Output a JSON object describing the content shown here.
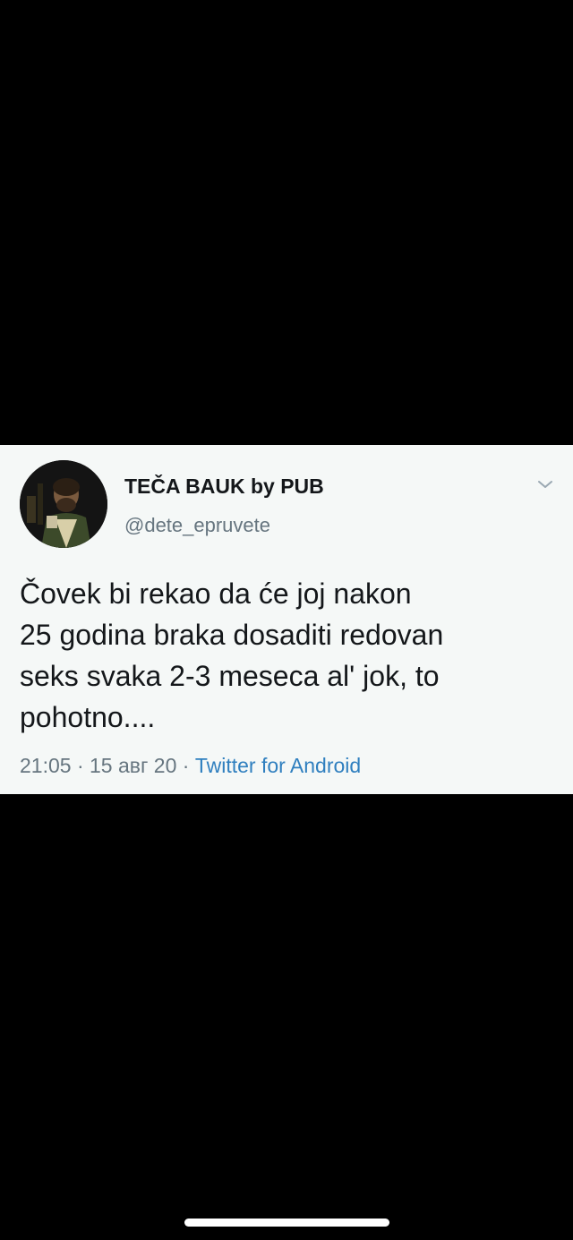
{
  "tweet": {
    "author_name": "TEČA BAUK by PUB",
    "author_handle": "@dete_epruvete",
    "text_lines": [
      "Čovek bi rekao da će joj nakon",
      "25 godina braka dosaditi redovan",
      "seks svaka 2-3 meseca al' jok, to",
      "pohotno...."
    ],
    "time": "21:05",
    "separator": " · ",
    "date": "15 авг 20",
    "source": "Twitter for Android",
    "menu_icon": "chevron-down-icon",
    "avatar_icon": "avatar"
  },
  "colors": {
    "background": "#000000",
    "card": "#f5f8f7",
    "text": "#14171a",
    "muted": "#66757f",
    "link": "#2f7fbf"
  }
}
